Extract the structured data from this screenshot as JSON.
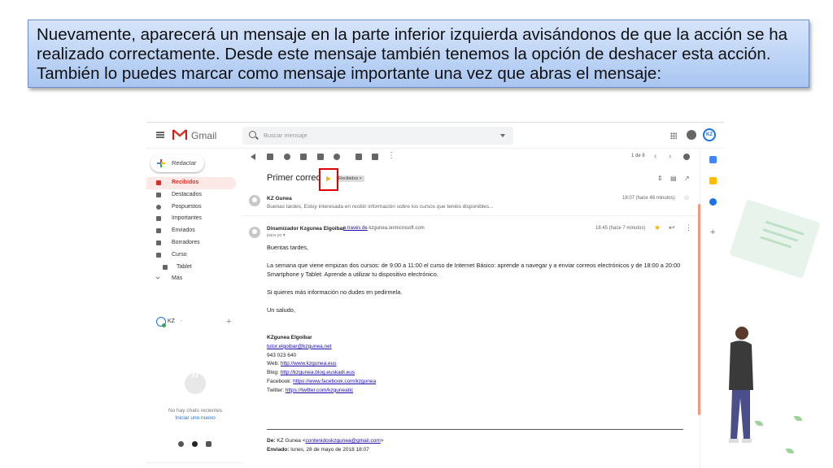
{
  "instruction": {
    "text": "Nuevamente, aparecerá un mensaje en la parte inferior izquierda avisándonos de que la acción se ha realizado correctamente. Desde este mensaje también tenemos la opción de deshacer esta acción. También lo puedes marcar como mensaje importante una vez que abras el mensaje:"
  },
  "gmail": {
    "brand": "Gmail",
    "search_placeholder": "Buscar mensaje",
    "compose_label": "Redactar",
    "nav": [
      {
        "label": "Recibidos",
        "active": true
      },
      {
        "label": "Destacados"
      },
      {
        "label": "Pospuestos"
      },
      {
        "label": "Importantes"
      },
      {
        "label": "Enviados"
      },
      {
        "label": "Borradores"
      },
      {
        "label": "Curso"
      },
      {
        "label": "Tablet"
      },
      {
        "label": "Más"
      }
    ],
    "account_short": "KZ",
    "account_dropdown": "-",
    "account_add": "+",
    "no_chats": "No hay chats recientes",
    "start_chat": "Iniciar uno nuevo",
    "pager": "1 de 8",
    "subject": "Primer correo",
    "label_chip": "Recibidos ×",
    "messages": [
      {
        "from": "KZ Gunea",
        "snippet": "Buenas tardes, Estoy interesada en recibir información sobre los cursos que tenéis disponibles...",
        "time": "18:07 (hace 46 minutos)"
      },
      {
        "from": "Dinamizador Kzgunea Elgoibar",
        "via_text": "a través de",
        "via_domain": "kzgunea.onmicrosoft.com",
        "to": "para yo ▾",
        "time": "18:45 (hace 7 minutos)"
      }
    ],
    "body": {
      "greeting": "Buentas tardes,",
      "p1": "La semana que viene empizan dos cursos: de 9:00 a 11:00 el curso de Internet Básico: aprende a navegar y a enviar correos electrónicos y de 18:00 a 20:00 Smartphone y Tablet: Aprende a utilizar tu dispositivo electrónico.",
      "p2": "Si quieres más información no dudes en pedirmela.",
      "closing": "Un saludo,"
    },
    "signature": {
      "name": "KZgunea Elgoibar",
      "email": "tutor.elgoibar@kzgunea.net",
      "phone": "943 023 640",
      "web_label": "Web:",
      "web": "http://www.kzgunea.eus",
      "blog_label": "Blog:",
      "blog": "http://kzgunea.blog.euskadi.eus",
      "facebook_label": "Facebook:",
      "facebook": "https://www.facebook.com/kzgunea",
      "twitter_label": "Twitter:",
      "twitter": "https://twitter.com/kzguneatic"
    },
    "forward": {
      "de_label": "De:",
      "de_name": "KZ Gunea <",
      "de_email": "contenidoskzgunea@gmail.com",
      "de_close": ">",
      "sent_label": "Enviado:",
      "sent_value": "lunes, 28 de mayo de 2018 18:07"
    }
  },
  "colors": {
    "accent_red": "#d93025",
    "highlight_box": "#e00000",
    "callout_bg": "#a9c6f1",
    "important_marker": "#f4b400"
  }
}
